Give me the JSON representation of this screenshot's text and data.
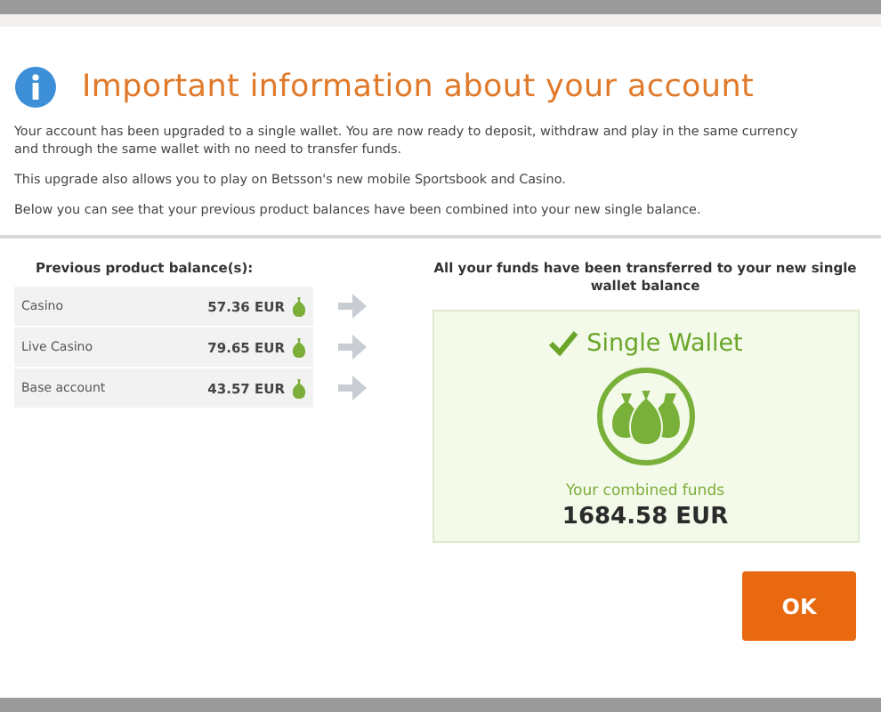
{
  "title": "Important information about your account",
  "paragraphs": [
    "Your account has been upgraded to a single wallet. You are now ready to deposit, withdraw and play in the same currency and through the same wallet with no need to transfer funds.",
    "This upgrade also allows you to play on Betsson's new mobile Sportsbook and Casino.",
    "Below you can see that your previous product balances have been combined into your new single balance."
  ],
  "previous": {
    "heading": "Previous product balance(s):",
    "rows": [
      {
        "name": "Casino",
        "amount": "57.36 EUR"
      },
      {
        "name": "Live Casino",
        "amount": "79.65 EUR"
      },
      {
        "name": "Base account",
        "amount": "43.57 EUR"
      }
    ]
  },
  "wallet": {
    "heading": "All your funds have been transferred to your new single wallet balance",
    "title": "Single Wallet",
    "caption": "Your combined funds",
    "total": "1684.58 EUR"
  },
  "buttons": [
    "OK"
  ]
}
